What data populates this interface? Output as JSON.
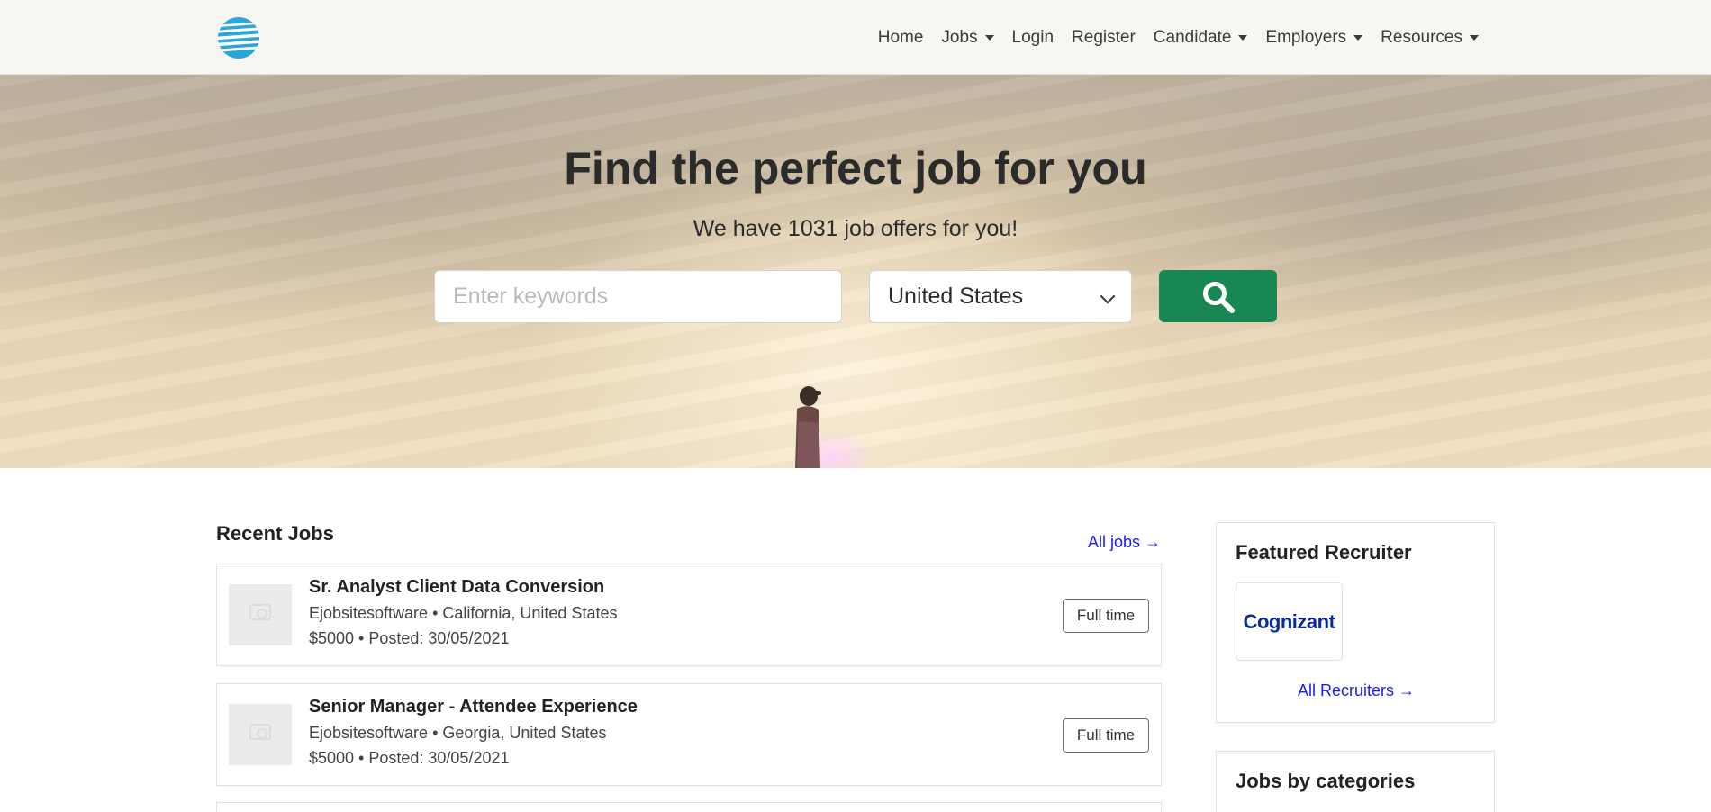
{
  "nav": {
    "items": [
      {
        "label": "Home",
        "dropdown": false
      },
      {
        "label": "Jobs",
        "dropdown": true
      },
      {
        "label": "Login",
        "dropdown": false
      },
      {
        "label": "Register",
        "dropdown": false
      },
      {
        "label": "Candidate",
        "dropdown": true
      },
      {
        "label": "Employers",
        "dropdown": true
      },
      {
        "label": "Resources",
        "dropdown": true
      }
    ]
  },
  "hero": {
    "title": "Find the perfect job for you",
    "subtitle": "We have 1031 job offers for you!",
    "search": {
      "placeholder": "Enter keywords",
      "country": "United States"
    }
  },
  "recent_jobs": {
    "title": "Recent Jobs",
    "all_link": "All jobs →",
    "jobs": [
      {
        "title": "Sr. Analyst Client Data Conversion",
        "company_location": "Ejobsitesoftware • California, United States",
        "salary_posted": "$5000 • Posted: 30/05/2021",
        "type": "Full time"
      },
      {
        "title": "Senior Manager - Attendee Experience",
        "company_location": "Ejobsitesoftware • Georgia, United States",
        "salary_posted": "$5000 • Posted: 30/05/2021",
        "type": "Full time"
      }
    ]
  },
  "featured_recruiter": {
    "title": "Featured Recruiter",
    "logo_text": "Cognizant",
    "all_link": "All Recruiters →"
  },
  "categories": {
    "title": "Jobs by categories"
  },
  "colors": {
    "search_button": "#198754",
    "link": "#1a1aff",
    "logo_blue": "#2aa6dd"
  }
}
